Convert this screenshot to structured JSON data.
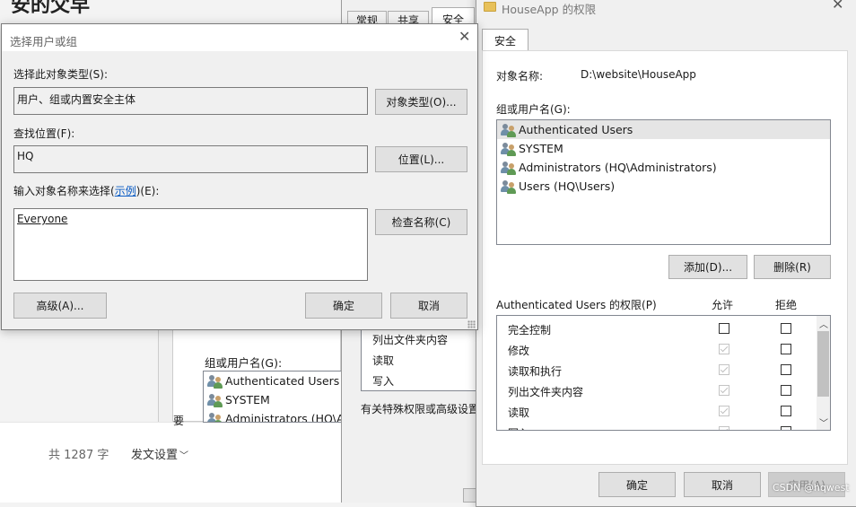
{
  "background": {
    "title_partial": "安的父早",
    "word_count": "共 1287 字",
    "publish_settings": "发文设置",
    "groups_label": "组或用户名(G):",
    "users": [
      "Authenticated Users",
      "SYSTEM",
      "Administrators (HQ\\Ad"
    ],
    "partial_char": "要"
  },
  "middle": {
    "tabs": [
      "常规",
      "共享",
      "安全"
    ],
    "perm_items": [
      "列出文件夹内容",
      "读取",
      "写入"
    ],
    "special_note": "有关特殊权限或高级设置"
  },
  "perm_dialog": {
    "title": "HouseApp 的权限",
    "tab": "安全",
    "object_label": "对象名称:",
    "object_value": "D:\\website\\HouseApp",
    "groups_label": "组或用户名(G):",
    "users": [
      "Authenticated Users",
      "SYSTEM",
      "Administrators (HQ\\Administrators)",
      "Users (HQ\\Users)"
    ],
    "add_button": "添加(D)...",
    "remove_button": "删除(R)",
    "perm_header": "Authenticated Users 的权限(P)",
    "allow": "允许",
    "deny": "拒绝",
    "permissions": [
      {
        "name": "完全控制",
        "allow": "empty",
        "deny": "empty"
      },
      {
        "name": "修改",
        "allow": "disabled",
        "deny": "empty"
      },
      {
        "name": "读取和执行",
        "allow": "disabled",
        "deny": "empty"
      },
      {
        "name": "列出文件夹内容",
        "allow": "disabled",
        "deny": "empty"
      },
      {
        "name": "读取",
        "allow": "disabled",
        "deny": "empty"
      },
      {
        "name": "写入",
        "allow": "disabled",
        "deny": "empty"
      }
    ],
    "ok": "确定",
    "cancel": "取消",
    "apply": "应用(A)",
    "watermark": "CSDN @hqwest"
  },
  "select_dialog": {
    "title": "选择用户或组",
    "obj_type_label": "选择此对象类型(S):",
    "obj_type_value": "用户、组或内置安全主体",
    "obj_type_button": "对象类型(O)...",
    "location_label": "查找位置(F):",
    "location_value": "HQ",
    "location_button": "位置(L)...",
    "enter_label_pre": "输入对象名称来选择(",
    "enter_label_link": "示例",
    "enter_label_post": ")(E):",
    "entered_name": "Everyone",
    "check_button": "检查名称(C)",
    "advanced_button": "高级(A)...",
    "ok": "确定",
    "cancel": "取消"
  }
}
